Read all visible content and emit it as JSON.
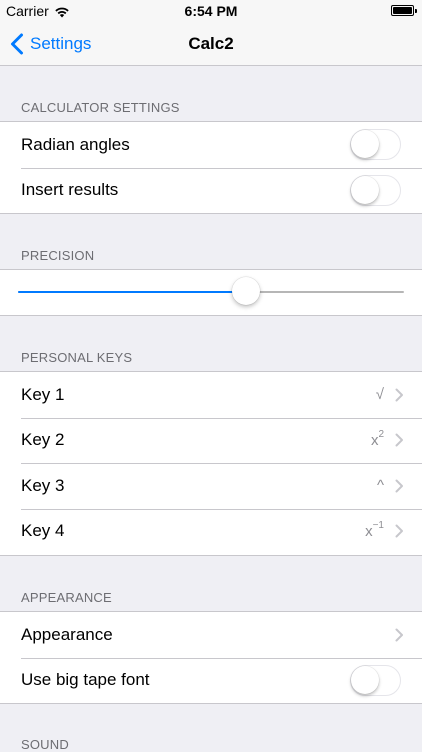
{
  "status_bar": {
    "carrier": "Carrier",
    "time": "6:54 PM",
    "wifi_icon": "wifi-icon",
    "battery_icon": "battery-icon"
  },
  "nav": {
    "back_label": "Settings",
    "back_icon": "chevron-left-icon",
    "title": "Calc2",
    "accent_color": "#007aff"
  },
  "sections": {
    "calculator": {
      "header": "CALCULATOR SETTINGS",
      "rows": [
        {
          "label": "Radian angles",
          "toggle_on": false
        },
        {
          "label": "Insert results",
          "toggle_on": false
        }
      ]
    },
    "precision": {
      "header": "PRECISION",
      "slider_value_fraction": 0.59
    },
    "personal_keys": {
      "header": "PERSONAL KEYS",
      "rows": [
        {
          "label": "Key 1",
          "value": "√"
        },
        {
          "label": "Key 2",
          "value_base": "x",
          "value_sup": "2"
        },
        {
          "label": "Key 3",
          "value": "^"
        },
        {
          "label": "Key 4",
          "value_base": "x",
          "value_sup": "−1"
        }
      ]
    },
    "appearance": {
      "header": "APPEARANCE",
      "rows": [
        {
          "label": "Appearance"
        },
        {
          "label": "Use big tape font",
          "toggle_on": false
        }
      ]
    },
    "sound": {
      "header": "SOUND"
    }
  }
}
